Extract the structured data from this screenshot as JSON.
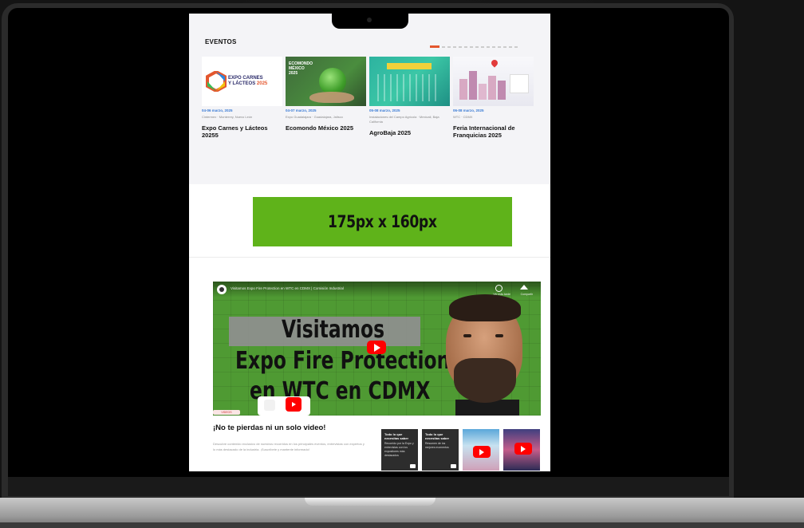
{
  "events": {
    "heading": "EVENTOS",
    "slider_dot_count": 15,
    "slider_active_index": 0,
    "cards": [
      {
        "logo_line1": "EXPO CARNES",
        "logo_line2": "Y LÁCTEOS",
        "logo_year": "2025",
        "date": "04-06 marzo, 2025",
        "location": "Cintermex · Monterrey, Nuevo León",
        "name": "Expo Carnes y Lácteos 20255"
      },
      {
        "thumb_line1": "ECOMONDO",
        "thumb_line2": "MÉXICO",
        "thumb_line3": "2025",
        "date": "04-07 marzo, 2025",
        "location": "Expo Guadalajara · Guadalajara, Jalisco",
        "name": "Ecomondo México 2025"
      },
      {
        "date": "05-08 marzo, 2025",
        "location": "Instalaciones del Campo Agrícola · Mexicali, Baja California",
        "name": "AgroBaja 2025"
      },
      {
        "date": "06-08 marzo, 2025",
        "location": "WTC · CDMX",
        "name": "Feria Internacional de Franquicias 2025"
      }
    ]
  },
  "ad": {
    "label": "175px x 160px"
  },
  "video": {
    "title_small": "Visitamos Expo Fire Protection en WTC en CDMX | Comisión Industrial",
    "watch_later_label": "Ver más tarde",
    "share_label": "Compartir",
    "line1": "Visitamos",
    "line2": "Expo  Fire Protection",
    "line3": "en WTC en CDMX"
  },
  "section": {
    "pill": "VIDEOS",
    "heading": "¡No te pierdas ni un solo video!",
    "paragraph": "Descubre contenido exclusivo de nuestros recorridos en los principales eventos, entrevistas con expertos y lo más destacado de la industria. ¡Suscríbete y mantente informado!"
  },
  "thumbs": [
    {
      "title": "Todo lo que necesitas saber",
      "text": "Recorrido por la Expo y entrevistas con los expositores más destacados"
    },
    {
      "title": "Todo lo que necesitas saber",
      "text": "Resumen de los mejores momentos"
    },
    {},
    {}
  ]
}
